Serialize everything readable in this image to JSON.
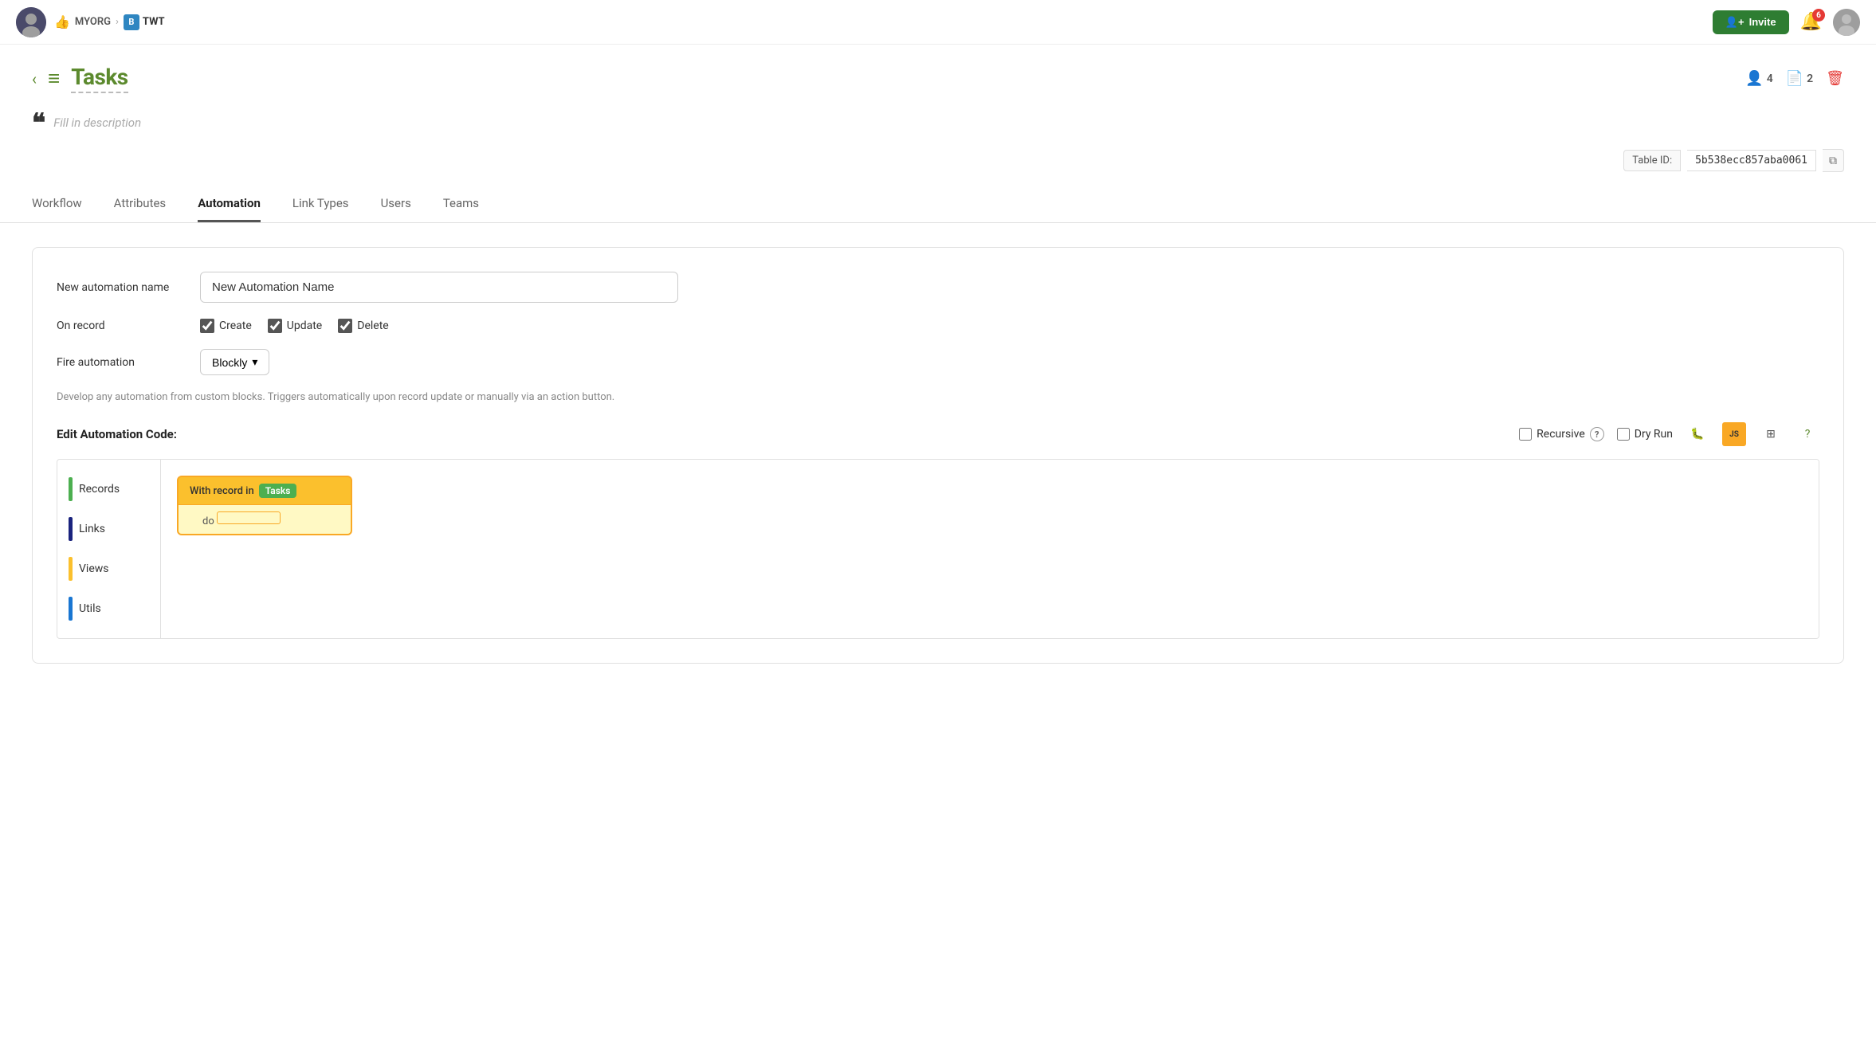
{
  "header": {
    "org_name": "MYORG",
    "org_sub": "TWT",
    "org_sub_letter": "B",
    "invite_label": "Invite",
    "bell_count": "6"
  },
  "page": {
    "title": "Tasks",
    "description_placeholder": "Fill in description",
    "table_id_label": "Table ID:",
    "table_id_value": "5b538ecc857aba0061",
    "users_count": "4",
    "files_count": "2"
  },
  "tabs": [
    {
      "id": "workflow",
      "label": "Workflow"
    },
    {
      "id": "attributes",
      "label": "Attributes"
    },
    {
      "id": "automation",
      "label": "Automation"
    },
    {
      "id": "link-types",
      "label": "Link Types"
    },
    {
      "id": "users",
      "label": "Users"
    },
    {
      "id": "teams",
      "label": "Teams"
    }
  ],
  "active_tab": "automation",
  "automation_form": {
    "name_label": "New automation name",
    "name_placeholder": "New Automation Name",
    "name_value": "New Automation Name",
    "on_record_label": "On record",
    "checkboxes": [
      {
        "id": "create",
        "label": "Create",
        "checked": true
      },
      {
        "id": "update",
        "label": "Update",
        "checked": true
      },
      {
        "id": "delete",
        "label": "Delete",
        "checked": true
      }
    ],
    "fire_label": "Fire automation",
    "fire_value": "Blockly",
    "fire_desc": "Develop any automation from custom blocks. Triggers automatically upon record update or manually via an action button.",
    "edit_code_title": "Edit Automation Code:",
    "recursive_label": "Recursive",
    "dry_run_label": "Dry Run",
    "blockly_sidebar": [
      {
        "id": "records",
        "label": "Records",
        "color": "#4caf50"
      },
      {
        "id": "links",
        "label": "Links",
        "color": "#1a237e"
      },
      {
        "id": "views",
        "label": "Views",
        "color": "#fbc02d"
      },
      {
        "id": "utils",
        "label": "Utils",
        "color": "#1976d2"
      }
    ],
    "block_with_text": "With record in",
    "block_task_label": "Tasks",
    "block_do_text": "do"
  }
}
